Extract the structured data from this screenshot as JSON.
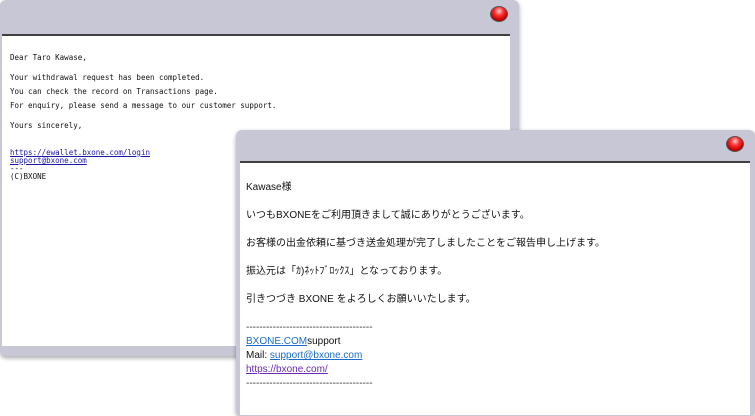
{
  "email_en": {
    "greeting": "Dear Taro Kawase,",
    "line1": "Your withdrawal request has been completed.",
    "line2": "You can check the record on Transactions page.",
    "line3": "For enquiry, please send a message to our customer support.",
    "closing": "Yours sincerely,",
    "link1": "https://ewallet.bxone.com/login",
    "link2": "support@bxone.com",
    "dashes": "---",
    "copyright": "(C)BXONE"
  },
  "email_jp": {
    "greeting": "Kawase様",
    "line1": "いつもBXONEをご利用頂きまして誠にありがとうございます。",
    "line2": "お客様の出金依頼に基づき送金処理が完了しましたことをご報告申し上げます。",
    "line3": "振込元は「ｶ)ﾈｯﾄﾌﾞﾛｯｸｽ」となっております。",
    "line4": "引きつづき BXONE をよろしくお願いいたします。",
    "separator": "--------------------------------------",
    "brand_link": "BXONE.COM",
    "brand_suffix": "support",
    "mail_label": "Mail: ",
    "mail_link": "support@bxone.com",
    "site_link": "https://bxone.com/",
    "separator2": "--------------------------------------"
  }
}
